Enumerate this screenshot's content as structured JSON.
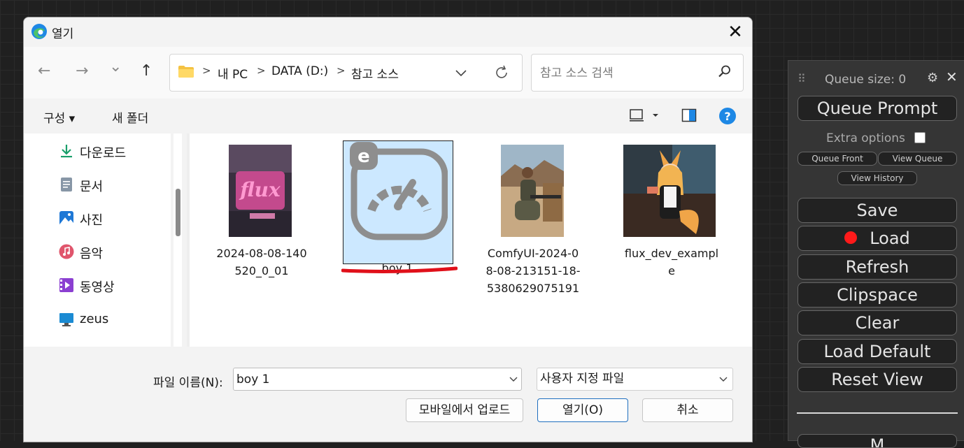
{
  "dialog": {
    "title": "열기",
    "close_glyph": "✕",
    "nav": {
      "back_glyph": "←",
      "forward_glyph": "→",
      "recent_glyph": "⌄",
      "up_glyph": "↑"
    },
    "breadcrumbs": [
      "내 PC",
      "DATA (D:)",
      "참고 소스"
    ],
    "crumb_sep": ">",
    "search_placeholder": "참고 소스 검색",
    "commands": {
      "organize": "구성 ▾",
      "new_folder": "새 폴더"
    },
    "sidebar": [
      {
        "label": "다운로드",
        "icon": "download-icon",
        "color": "#1a9f6b"
      },
      {
        "label": "문서",
        "icon": "document-icon",
        "color": "#6b7b8c"
      },
      {
        "label": "사진",
        "icon": "photo-icon",
        "color": "#1e78d6"
      },
      {
        "label": "음악",
        "icon": "music-icon",
        "color": "#e0556c"
      },
      {
        "label": "동영상",
        "icon": "video-icon",
        "color": "#8b3fd1"
      },
      {
        "label": "zeus",
        "icon": "monitor-icon",
        "color": "#1b8bd3"
      }
    ],
    "files": [
      {
        "name": "2024-08-08-140520_0_01",
        "lines": [
          "2024-08-08-140",
          "520_0_01"
        ]
      },
      {
        "name": "boy 1",
        "lines": [
          "boy 1"
        ],
        "selected": true
      },
      {
        "name": "ComfyUI-2024-08-08-213151-18-5380629075191",
        "lines": [
          "ComfyUI-2024-0",
          "8-08-213151-18-",
          "5380629075191"
        ]
      },
      {
        "name": "flux_dev_example",
        "lines": [
          "flux_dev_exampl",
          "e"
        ]
      }
    ],
    "thumb_text": {
      "flux_graffiti": "flux",
      "app_badge": "e"
    },
    "filename_label": "파일 이름(N):",
    "filename_value": "boy 1",
    "filetype": "사용자 지정 파일",
    "buttons": {
      "upload": "모바일에서 업로드",
      "open": "열기(O)",
      "cancel": "취소"
    },
    "help_glyph": "?"
  },
  "panel": {
    "grip_glyph": "⠿",
    "queue_size": "Queue size: 0",
    "gear_glyph": "⚙",
    "close_glyph": "✕",
    "queue_prompt": "Queue Prompt",
    "extra_options": "Extra options",
    "queue_front": "Queue Front",
    "view_queue": "View Queue",
    "view_history": "View History",
    "save": "Save",
    "load": "Load",
    "refresh": "Refresh",
    "clipspace": "Clipspace",
    "clear": "Clear",
    "load_default": "Load Default",
    "reset_view": "Reset View",
    "manager_partial": "M"
  },
  "colors": {
    "accent": "#1f6fbf",
    "selection": "#cce8ff",
    "annotation": "#e0101a"
  }
}
